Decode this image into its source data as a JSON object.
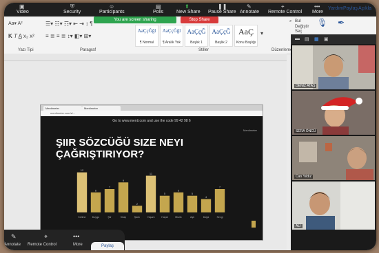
{
  "zoom_toolbar": {
    "items": [
      "Video",
      "Security",
      "Participants",
      "Polls",
      "New Share",
      "Pause Share",
      "Annotate",
      "Remote Control",
      "More"
    ],
    "sharing_status": "You are screen sharing",
    "stop_share": "Stop Share"
  },
  "word_tabs": [
    "Yardım",
    "Paylaş",
    "Açıkla"
  ],
  "ribbon": {
    "styles": [
      {
        "sample": "AaÇçĞğl",
        "name": "¶ Normal"
      },
      {
        "sample": "AaÇçĞğl",
        "name": "¶ Aralık Yok"
      },
      {
        "sample": "AaÇçĞ",
        "name": "Başlık 1"
      },
      {
        "sample": "AaÇçĞ",
        "name": "Başlık 2"
      },
      {
        "sample": "AaÇ",
        "name": "Konu Başlığı"
      }
    ],
    "group_labels": [
      "Yazı Tipi",
      "Paragraf",
      "Stiller",
      "Düzenleme"
    ],
    "editing": [
      "Bul",
      "Değiştir",
      "Seç"
    ]
  },
  "browser": {
    "tab_label": "Mentimeter",
    "address": "mentimeter.com/s/..."
  },
  "slide": {
    "join_text": "Go to www.menti.com and use the code 99 42 98 6",
    "question": "ŞIIR SÖZCÜĞÜ SIZE NEYI\nÇAĞRIŞTIRIYOR?",
    "logo": "Mentimeter"
  },
  "chart_data": {
    "type": "bar",
    "categories": [
      "Kelime",
      "Duygu",
      "Şiir",
      "Kitap",
      "Şarkı",
      "Yaşam",
      "Hayal",
      "Müzik",
      "Aşk",
      "Doğa",
      "Sevgi"
    ],
    "values": [
      12,
      6,
      7,
      9,
      2,
      11,
      5,
      6,
      5,
      4,
      7
    ],
    "ylim": [
      0,
      14
    ],
    "colors": {
      "bar": "#c4a64e",
      "bar_highlight": "#dcc176"
    }
  },
  "gallery": {
    "participants": [
      {
        "name": "DENİZ ATAŞ",
        "bg": "#b9b6ad",
        "skin": "#c99a74",
        "hat": false
      },
      {
        "name": "SERA ÖNCÜ",
        "bg": "#7a6d66",
        "skin": "#d8ad8a",
        "hat": true
      },
      {
        "name": "Can Yıldız",
        "bg": "#8e8479",
        "skin": "#caa080",
        "hat": false
      },
      {
        "name": "ALİ",
        "bg": "#d7d7d2",
        "skin": "#c79774",
        "hat": false
      }
    ]
  },
  "bottom_bar": {
    "items": [
      "Annotate",
      "Remote Control",
      "More"
    ],
    "paylas": "Paylaş"
  }
}
